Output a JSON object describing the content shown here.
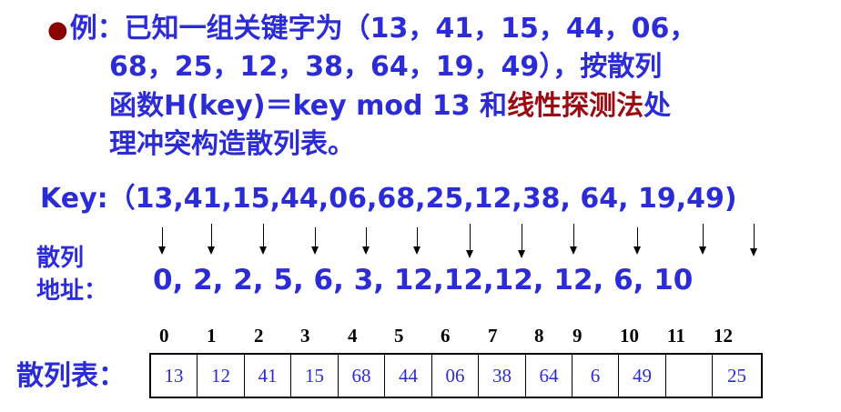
{
  "statement": {
    "bullet": "●",
    "prefix": "例：已知一组关键字为（13，41，15，44，06，",
    "line2": "68，25，12，38，64，19，49），按散列",
    "line3_a": "函数H(key)＝key mod 13 和",
    "line3_highlight": "线性探测法",
    "line3_b": "处",
    "line4": "理冲突构造散列表。"
  },
  "key_line": "Key:（13,41,15,44,06,68,25,12,38, 64, 19,49)",
  "hash_address": {
    "label_line1": "散列",
    "label_line2": "地址：",
    "values": "0, 2, 2, 5, 6, 3, 12,12,12, 12, 6, 10"
  },
  "hash_table": {
    "label": "散列表：",
    "indices": [
      "0",
      "1",
      "2",
      "3",
      "4",
      "5",
      "6",
      "7",
      "8",
      "9",
      "10",
      "11",
      "12"
    ],
    "cells": [
      "13",
      "12",
      "41",
      "15",
      "68",
      "44",
      "06",
      "38",
      "64",
      "6",
      "49",
      "",
      "25"
    ]
  },
  "colors": {
    "text_blue": "#2c2cd6",
    "highlight_red": "#9b0b12",
    "bullet": "#8b0000"
  }
}
